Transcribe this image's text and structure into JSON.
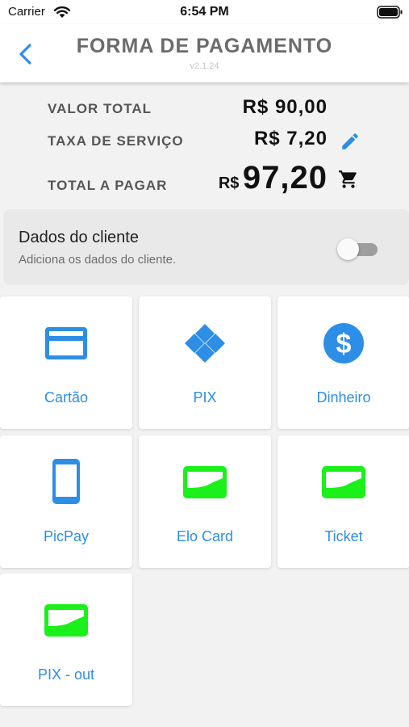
{
  "status_bar": {
    "carrier": "Carrier",
    "time": "6:54 PM"
  },
  "header": {
    "title": "FORMA DE PAGAMENTO",
    "version": "v2.1.24",
    "back_icon": "chevron-left-icon"
  },
  "summary": {
    "total_label": "VALOR TOTAL",
    "total_value": "R$ 90,00",
    "fee_label": "TAXA DE SERVIÇO",
    "fee_value": "R$ 7,20",
    "pay_label": "TOTAL A PAGAR",
    "pay_currency": "R$",
    "pay_amount": "97,20",
    "edit_icon": "pencil-icon",
    "cart_icon": "cart-icon"
  },
  "customer": {
    "title": "Dados do cliente",
    "subtitle": "Adiciona os dados do cliente.",
    "toggle_on": false
  },
  "payment_methods": [
    {
      "label": "Cartão",
      "icon": "credit-card-icon"
    },
    {
      "label": "PIX",
      "icon": "pix-icon"
    },
    {
      "label": "Dinheiro",
      "icon": "dollar-coin-icon"
    },
    {
      "label": "PicPay",
      "icon": "smartphone-icon"
    },
    {
      "label": "Elo Card",
      "icon": "wallet-card-icon"
    },
    {
      "label": "Ticket",
      "icon": "wallet-card-icon"
    },
    {
      "label": "PIX - out",
      "icon": "wallet-card-icon"
    }
  ],
  "colors": {
    "accent_blue": "#2d8ee6",
    "voucher_green": "#1bf01b",
    "title_gray": "#6b6b6b"
  }
}
